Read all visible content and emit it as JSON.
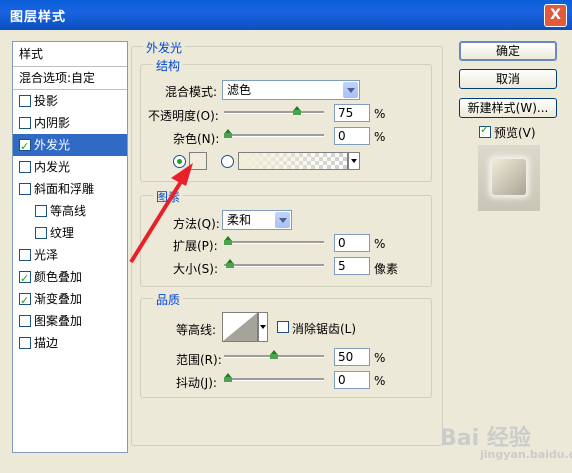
{
  "window": {
    "title": "图层样式",
    "close_label": "X"
  },
  "style_list": {
    "header": "样式",
    "blend": "混合选项:自定",
    "items": [
      {
        "label": "投影",
        "checked": false,
        "sub": false,
        "selected": false
      },
      {
        "label": "内阴影",
        "checked": false,
        "sub": false,
        "selected": false
      },
      {
        "label": "外发光",
        "checked": true,
        "sub": false,
        "selected": true
      },
      {
        "label": "内发光",
        "checked": false,
        "sub": false,
        "selected": false
      },
      {
        "label": "斜面和浮雕",
        "checked": false,
        "sub": false,
        "selected": false
      },
      {
        "label": "等高线",
        "checked": false,
        "sub": true,
        "selected": false
      },
      {
        "label": "纹理",
        "checked": false,
        "sub": true,
        "selected": false
      },
      {
        "label": "光泽",
        "checked": false,
        "sub": false,
        "selected": false
      },
      {
        "label": "颜色叠加",
        "checked": true,
        "sub": false,
        "selected": false
      },
      {
        "label": "渐变叠加",
        "checked": true,
        "sub": false,
        "selected": false
      },
      {
        "label": "图案叠加",
        "checked": false,
        "sub": false,
        "selected": false
      },
      {
        "label": "描边",
        "checked": false,
        "sub": false,
        "selected": false
      }
    ]
  },
  "outer_glow": {
    "title": "外发光",
    "structure": {
      "title": "结构",
      "blend_mode_label": "混合模式:",
      "blend_mode_value": "滤色",
      "opacity_label": "不透明度(O):",
      "opacity_value": "75",
      "opacity_unit": "%",
      "opacity_level": 0.75,
      "noise_label": "杂色(N):",
      "noise_value": "0",
      "noise_unit": "%",
      "noise_level": 0
    },
    "elements": {
      "title": "图素",
      "technique_label": "方法(Q):",
      "technique_value": "柔和",
      "spread_label": "扩展(P):",
      "spread_value": "0",
      "spread_unit": "%",
      "spread_level": 0,
      "size_label": "大小(S):",
      "size_value": "5",
      "size_unit": "像素",
      "size_level": 0.02
    },
    "quality": {
      "title": "品质",
      "contour_label": "等高线:",
      "antialias_label": "消除锯齿(L)",
      "antialias_checked": false,
      "range_label": "范围(R):",
      "range_value": "50",
      "range_unit": "%",
      "range_level": 0.5,
      "jitter_label": "抖动(J):",
      "jitter_value": "0",
      "jitter_unit": "%",
      "jitter_level": 0
    }
  },
  "buttons": {
    "ok": "确定",
    "cancel": "取消",
    "new_style": "新建样式(W)...",
    "preview_label": "预览(V)",
    "preview_checked": true
  },
  "watermark": {
    "brand": "Bai 经验",
    "url": "jingyan.baidu.com"
  },
  "colors": {
    "accent": "#316ac5",
    "legend": "#0046d5",
    "annotation": "#e8202a",
    "titlebar": "#0a5fd8"
  }
}
